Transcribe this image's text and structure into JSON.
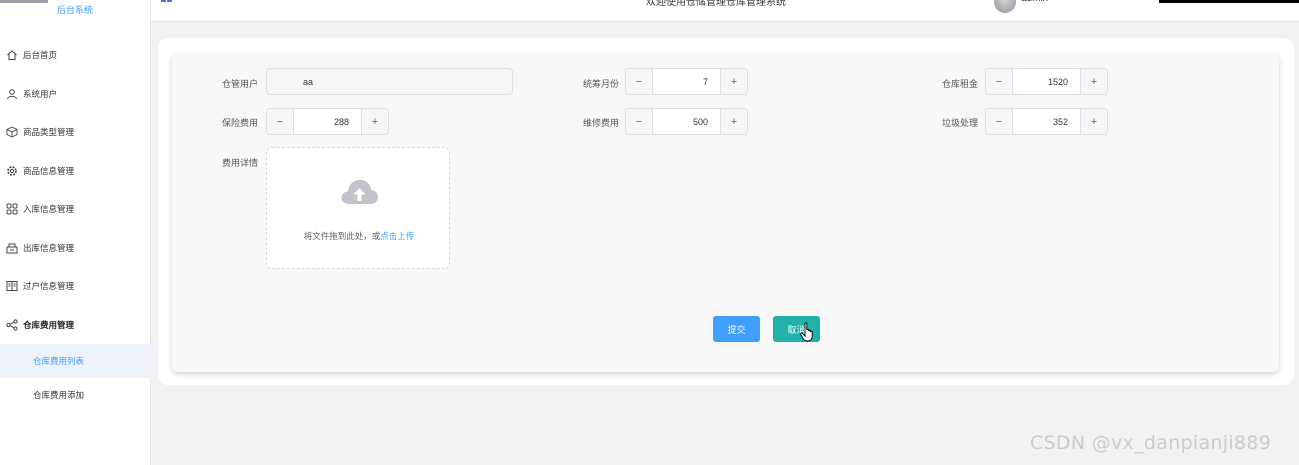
{
  "sidebar": {
    "subtitle": "后台系统",
    "menu": [
      {
        "label": "后台首页",
        "icon": "home-icon"
      },
      {
        "label": "系统用户",
        "icon": "user-icon"
      },
      {
        "label": "商品类型管理",
        "icon": "box-icon"
      },
      {
        "label": "商品信息管理",
        "icon": "gear-icon"
      },
      {
        "label": "入库信息管理",
        "icon": "grid-icon"
      },
      {
        "label": "出库信息管理",
        "icon": "tray-icon"
      },
      {
        "label": "过户信息管理",
        "icon": "ledger-icon"
      },
      {
        "label": "仓库费用管理",
        "icon": "share-icon"
      }
    ],
    "submenu": [
      {
        "label": "仓库费用列表",
        "active": true
      },
      {
        "label": "仓库费用添加",
        "active": false
      }
    ]
  },
  "header": {
    "title": "欢迎使用仓储管理仓库管理系统",
    "username": "admin"
  },
  "form": {
    "warehouse_user": {
      "label": "仓管用户",
      "value": "aa"
    },
    "stat_month": {
      "label": "统筹月份",
      "value": "7"
    },
    "warehouse_rent": {
      "label": "仓库租金",
      "value": "1520"
    },
    "insurance_fee": {
      "label": "保险费用",
      "value": "288"
    },
    "maintenance_fee": {
      "label": "维修费用",
      "value": "500"
    },
    "garbage_fee": {
      "label": "垃圾处理",
      "value": "352"
    },
    "fee_detail": {
      "label": "费用详情"
    },
    "upload": {
      "text": "将文件拖到此处，或",
      "link": "点击上传"
    },
    "submit_label": "提交",
    "cancel_label": "取消"
  },
  "watermark": "CSDN @vx_danpianji889",
  "colors": {
    "primary": "#409eff",
    "cancel": "#20b2aa"
  }
}
